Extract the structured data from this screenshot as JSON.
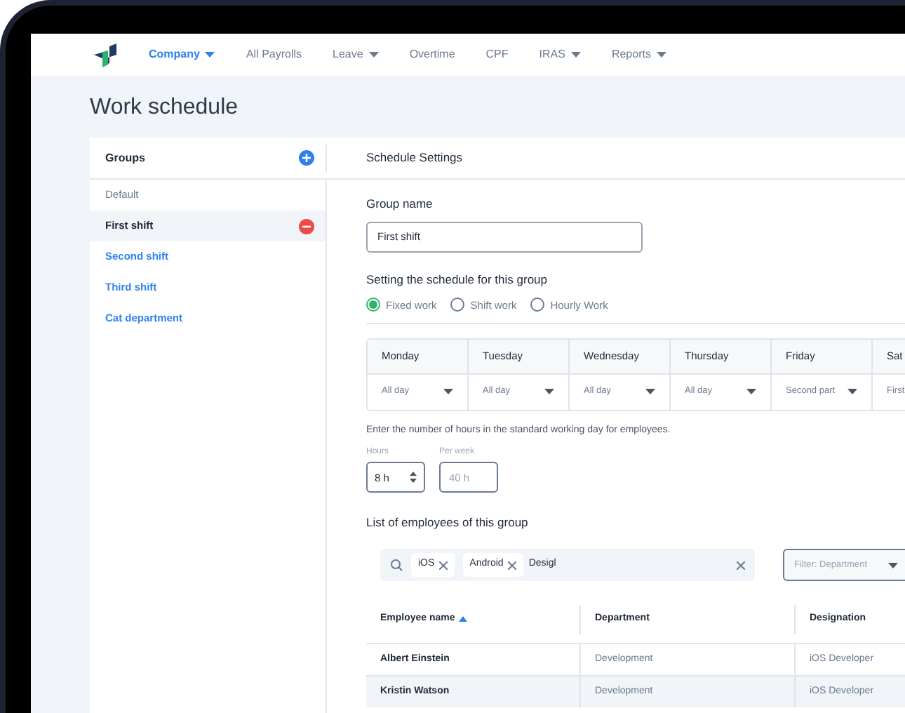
{
  "nav": [
    {
      "label": "Company",
      "selected": true,
      "dropdown": true
    },
    {
      "label": "All Payrolls",
      "selected": false,
      "dropdown": false
    },
    {
      "label": "Leave",
      "selected": false,
      "dropdown": true
    },
    {
      "label": "Overtime",
      "selected": false,
      "dropdown": false
    },
    {
      "label": "CPF",
      "selected": false,
      "dropdown": false
    },
    {
      "label": "IRAS",
      "selected": false,
      "dropdown": true
    },
    {
      "label": "Reports",
      "selected": false,
      "dropdown": true
    }
  ],
  "page_title": "Work schedule",
  "sidebar": {
    "title": "Groups",
    "items": [
      {
        "label": "Default",
        "selected": false,
        "kind": "default"
      },
      {
        "label": "First shift",
        "selected": true,
        "kind": "custom"
      },
      {
        "label": "Second shift",
        "selected": false,
        "kind": "custom"
      },
      {
        "label": "Third shift",
        "selected": false,
        "kind": "custom"
      },
      {
        "label": "Cat department",
        "selected": false,
        "kind": "custom"
      }
    ]
  },
  "settings": {
    "title": "Schedule Settings",
    "group_name_label": "Group name",
    "group_name_value": "First shift",
    "schedule_label": "Setting the schedule for this group",
    "schedule_types": [
      {
        "label": "Fixed work",
        "selected": true
      },
      {
        "label": "Shift work",
        "selected": false
      },
      {
        "label": "Hourly Work",
        "selected": false
      }
    ],
    "days": [
      {
        "day": "Monday",
        "value": "All day"
      },
      {
        "day": "Tuesday",
        "value": "All day"
      },
      {
        "day": "Wednesday",
        "value": "All day"
      },
      {
        "day": "Thursday",
        "value": "All day"
      },
      {
        "day": "Friday",
        "value": "Second part"
      },
      {
        "day": "Sat",
        "value": "First"
      }
    ],
    "hours_hint": "Enter the number of hours in the standard working day for employees.",
    "hours": {
      "label": "Hours",
      "value": "8 h"
    },
    "per_week": {
      "label": "Per week",
      "placeholder": "40 h"
    }
  },
  "employees": {
    "title": "List of employees of this group",
    "tags": [
      "iOS",
      "Android"
    ],
    "search_value": "Desigl",
    "filter": "Filter: Department",
    "columns": [
      "Employee name",
      "Department",
      "Designation"
    ],
    "rows": [
      {
        "cells": [
          "Albert Einstein",
          "Development",
          "iOS Developer"
        ],
        "selected": false
      },
      {
        "cells": [
          "Kristin Watson",
          "Development",
          "iOS Developer"
        ],
        "selected": true
      }
    ]
  }
}
